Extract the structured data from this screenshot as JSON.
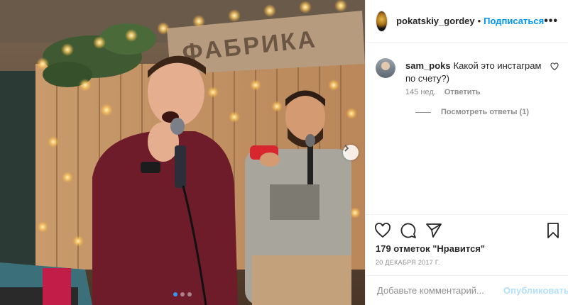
{
  "post": {
    "image_alt": "",
    "sign_text": "ФАБРИКА",
    "carousel_count": 3,
    "carousel_active": 1
  },
  "header": {
    "username": "pokatskiy_gordey",
    "separator": "•",
    "follow_label": "Подписаться",
    "more_label": "•••"
  },
  "comments": [
    {
      "username": "sam_poks",
      "text": "Какой это инстаграм по счету?)",
      "age": "145 нед.",
      "reply_label": "Ответить",
      "view_replies": "Посмотреть ответы (1)"
    }
  ],
  "footer": {
    "likes": "179 отметок \"Нравится\"",
    "date": "20 ДЕКАБРЯ 2017 Г.",
    "comment_placeholder": "Добавьте комментарий...",
    "publish_label": "Опубликовать"
  },
  "icons": {
    "like": "heart-icon",
    "comment": "comment-icon",
    "share": "share-icon",
    "save": "bookmark-icon",
    "next": "chevron-right-icon"
  },
  "colors": {
    "link": "#0095f6",
    "publish_disabled": "#b2dffc",
    "meta": "#8e8e8e",
    "carousel_active": "#3897f0"
  }
}
